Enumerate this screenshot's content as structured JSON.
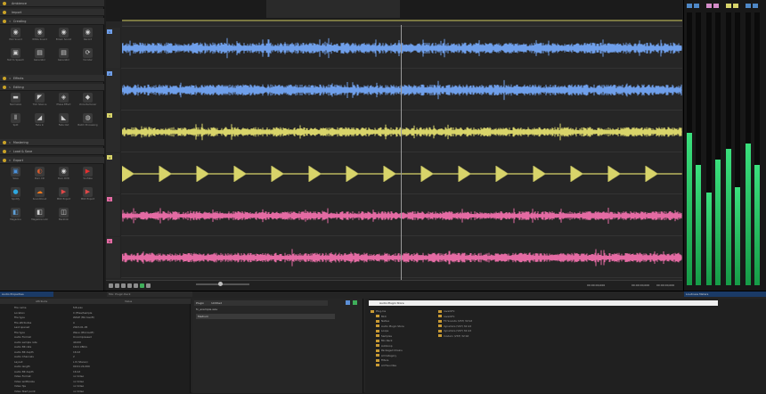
{
  "sidebar": {
    "sections": [
      {
        "num": "",
        "label": "Ambience"
      },
      {
        "num": "",
        "label": "Import"
      },
      {
        "num": "3",
        "label": "Creating"
      },
      {
        "num": "4",
        "label": "Effects"
      },
      {
        "num": "5",
        "label": "Editing"
      },
      {
        "num": "6",
        "label": "Mastering"
      },
      {
        "num": "7",
        "label": "Load & Save"
      },
      {
        "num": "8",
        "label": "Export"
      }
    ],
    "creating": [
      {
        "label": "Pink Sound",
        "icon": "globe-icon",
        "glyph": "◉"
      },
      {
        "label": "White Sound",
        "icon": "globe-icon",
        "glyph": "◉"
      },
      {
        "label": "Brown Sound",
        "icon": "globe-icon",
        "glyph": "◉"
      },
      {
        "label": "Record",
        "icon": "globe-icon",
        "glyph": "◉"
      },
      {
        "label": "Text to Speech",
        "icon": "speech-icon",
        "glyph": "▣"
      },
      {
        "label": "Generator",
        "icon": "generator-icon",
        "glyph": "▤"
      },
      {
        "label": "Generator",
        "icon": "generator-icon",
        "glyph": "▤"
      },
      {
        "label": "Vocoder",
        "icon": "refresh-icon",
        "glyph": "⟳"
      }
    ],
    "editing": [
      {
        "label": "Normalize",
        "icon": "normalize-icon",
        "glyph": "▬"
      },
      {
        "label": "Trim Silence",
        "icon": "trim-icon",
        "glyph": "◤"
      },
      {
        "label": "Phase Effect",
        "icon": "phase-icon",
        "glyph": "◈"
      },
      {
        "label": "Voice Remover",
        "icon": "voice-icon",
        "glyph": "◆"
      },
      {
        "label": "Split",
        "icon": "split-icon",
        "glyph": "⦀"
      },
      {
        "label": "Fade In",
        "icon": "fade-icon",
        "glyph": "◢"
      },
      {
        "label": "Fade Out",
        "icon": "fade-icon",
        "glyph": "◣"
      },
      {
        "label": "Batch Processing",
        "icon": "batch-icon",
        "glyph": "◍"
      }
    ],
    "export": [
      {
        "label": "Save",
        "icon": "save-icon",
        "glyph": "▣",
        "color": "#4a90d9"
      },
      {
        "label": "Burn CD",
        "icon": "burn-icon",
        "glyph": "◐",
        "color": "#d35b2e"
      },
      {
        "label": "Burn DVD",
        "icon": "disc-icon",
        "glyph": "◉",
        "color": "#d9d9d9"
      },
      {
        "label": "YouTube",
        "icon": "youtube-icon",
        "glyph": "▶",
        "color": "#e53030"
      },
      {
        "label": "Spotify",
        "icon": "spotify-icon",
        "glyph": "●",
        "color": "#2ea8e0"
      },
      {
        "label": "SoundCloud",
        "icon": "soundcloud-icon",
        "glyph": "☁",
        "color": "#ff7b1c"
      },
      {
        "label": "MOV Export",
        "icon": "video-icon",
        "glyph": "▶",
        "color": "#e04848"
      },
      {
        "label": "MOV Export",
        "icon": "video-icon",
        "glyph": "▶",
        "color": "#e04848"
      },
      {
        "label": "Magazine",
        "icon": "magazine-icon",
        "glyph": "◧",
        "color": "#5fa0d8"
      },
      {
        "label": "Magazine Link",
        "icon": "magazine-icon",
        "glyph": "◧",
        "color": "#cfcfcf"
      },
      {
        "label": "Backlink",
        "icon": "link-icon",
        "glyph": "◫",
        "color": "#cfcfcf"
      }
    ]
  },
  "tracks": [
    {
      "id": "1",
      "color": "#6f9fea",
      "amp": 0.35,
      "style": "dense"
    },
    {
      "id": "2",
      "color": "#6f9fea",
      "amp": 0.35,
      "style": "dense"
    },
    {
      "id": "3",
      "color": "#d8d46a",
      "amp": 0.3,
      "style": "dense"
    },
    {
      "id": "4",
      "color": "#d8d46a",
      "amp": 0.5,
      "style": "bursts"
    },
    {
      "id": "5",
      "color": "#e46ba3",
      "amp": 0.28,
      "style": "dense"
    },
    {
      "id": "6",
      "color": "#e46ba3",
      "amp": 0.3,
      "style": "dense"
    }
  ],
  "editor": {
    "transport_label": "Mix: Plugin Rack",
    "time_left": "00:00:00,000",
    "time_right": "00:00:00,000",
    "time_end": "00:00:00,000"
  },
  "meters": {
    "title": "Loudness Meters",
    "levels": [
      0.56,
      0.44,
      0.34,
      0.46,
      0.5,
      0.36,
      0.52,
      0.44
    ],
    "channel_colors": [
      "#4e88c7",
      "#d48cc8",
      "#d8d46a",
      "#4e88c7"
    ]
  },
  "bottom": {
    "props_title": "Audio Properties",
    "props_header": [
      "Attribute",
      "Value"
    ],
    "props_rows": [
      [
        "File name",
        "fx8.wav"
      ],
      [
        "Location",
        "C:\\Files\\Sample"
      ],
      [
        "File type",
        "WAVE (Microsoft)"
      ],
      [
        "File attributes",
        "A"
      ],
      [
        "Last opened",
        "2023-01-05"
      ],
      [
        "File type",
        "Wave (Microsoft)"
      ],
      [
        "Audio Format",
        "Uncompressed"
      ],
      [
        "Audio sample rate",
        "44100"
      ],
      [
        "Audio Bit rate",
        "1411 kBit/s"
      ],
      [
        "Audio Bit depth",
        "16 bit"
      ],
      [
        "Audio Channels",
        "2"
      ],
      [
        "Layout",
        "L R (Stereo)"
      ],
      [
        "Audio length",
        "00:01:24,000"
      ],
      [
        "Audio Bit depth",
        "16 bit"
      ],
      [
        "Video Format",
        "no Video"
      ],
      [
        "Video width/size",
        "no Video"
      ],
      [
        "Video fps",
        "no Video"
      ],
      [
        "Video Start point",
        "no Video"
      ]
    ],
    "plugin_title": "Plugin",
    "plugin_tab": "Untitled",
    "plugin_preset": "Medium",
    "plugin_sample": "fx_example.wav",
    "browser_title": "Audio Plugin Store",
    "browser_tree": [
      "Plug-Ins",
      "Midi",
      "Native",
      "Audio Plugin Store",
      "Loops",
      "Samples",
      "Mix Rack",
      "Autoloop",
      "Packaged Chains",
      "All Category",
      "Filters",
      "All Favorites"
    ],
    "browser_files": [
      "reverbFx",
      "reverbFx",
      "FX Sounds (VST) 32 bit",
      "dynamics (VST) 32 bit",
      "dynamics (VST) 32 bit",
      "modern (VST) 32 bit"
    ]
  }
}
